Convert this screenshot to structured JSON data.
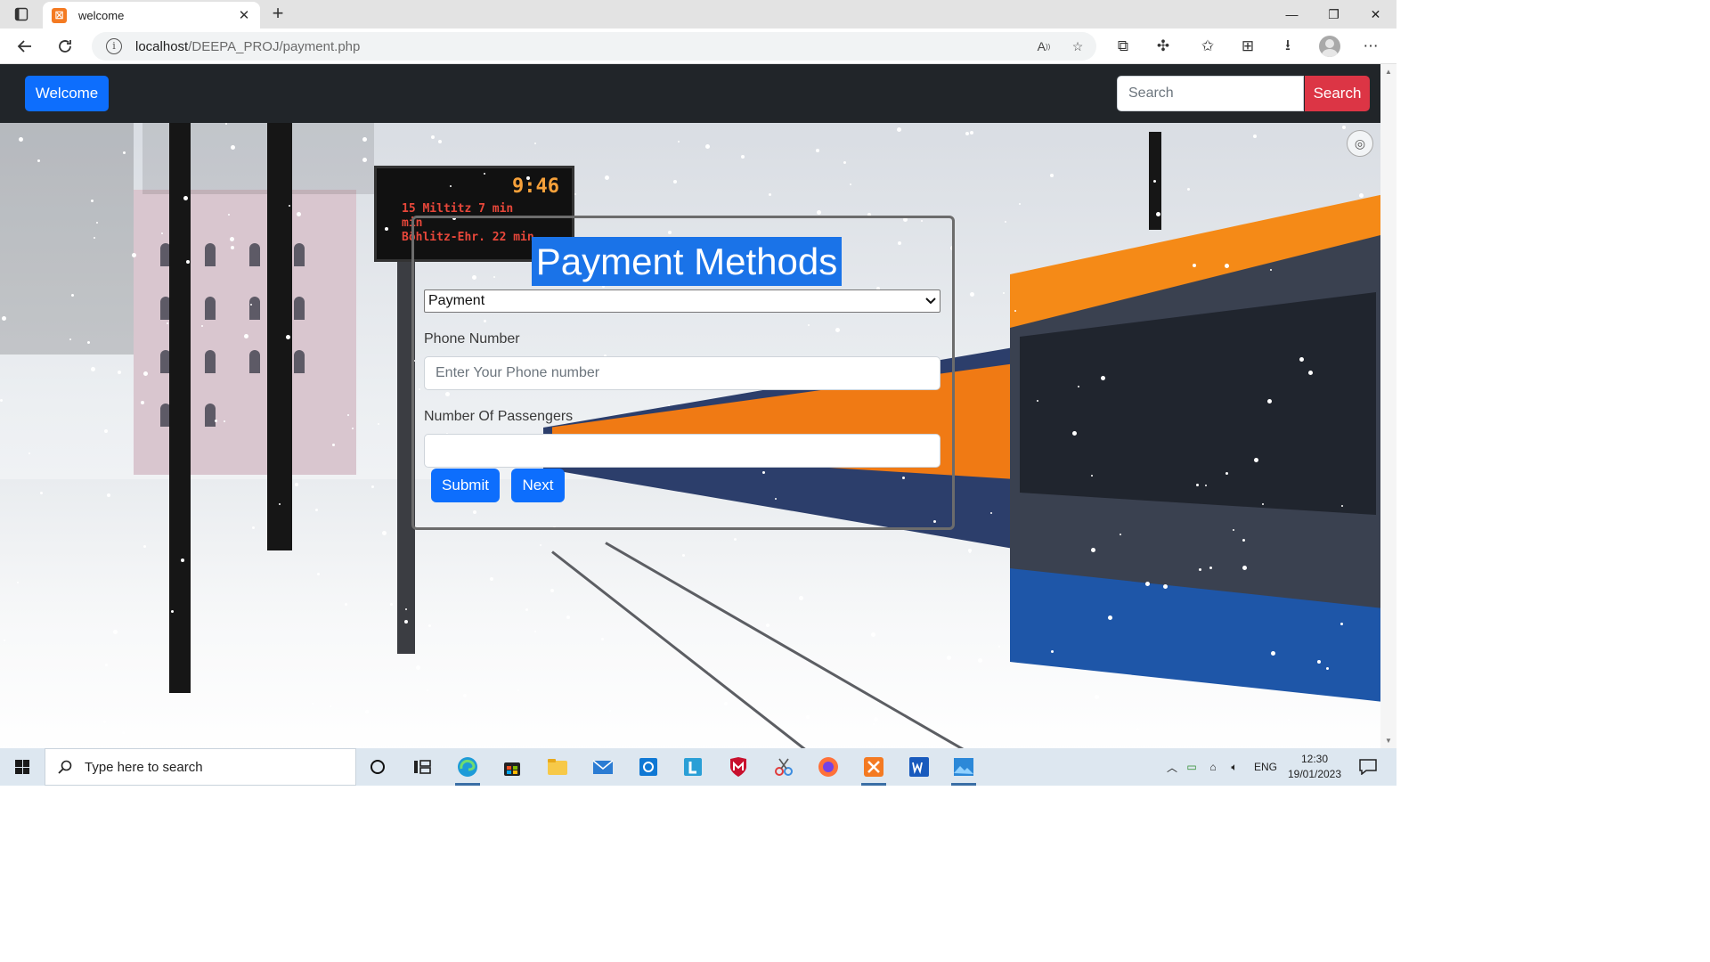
{
  "browser": {
    "tab_title": "welcome",
    "url_host": "localhost",
    "url_path": "/DEEPA_PROJ/payment.php"
  },
  "navbar": {
    "brand_label": "Welcome",
    "search_placeholder": "Search",
    "search_button": "Search"
  },
  "form": {
    "title": "Payment Methods",
    "select_value": "Payment",
    "phone_label": "Phone Number",
    "phone_placeholder": "Enter Your Phone number",
    "passengers_label": "Number Of Passengers",
    "passengers_value": "",
    "submit_label": "Submit",
    "next_label": "Next"
  },
  "scene": {
    "sign_time": "9:46",
    "sign_lines": [
      "15 Miltitz        7 min",
      "                           min",
      "Böhlitz-Ehr.  22 min"
    ]
  },
  "taskbar": {
    "search_placeholder": "Type here to search",
    "language": "ENG",
    "time": "12:30",
    "date": "19/01/2023"
  },
  "colors": {
    "navbar_bg": "#212529",
    "primary": "#0d6efd",
    "danger": "#dc3545",
    "title_highlight": "#1a73e8"
  }
}
